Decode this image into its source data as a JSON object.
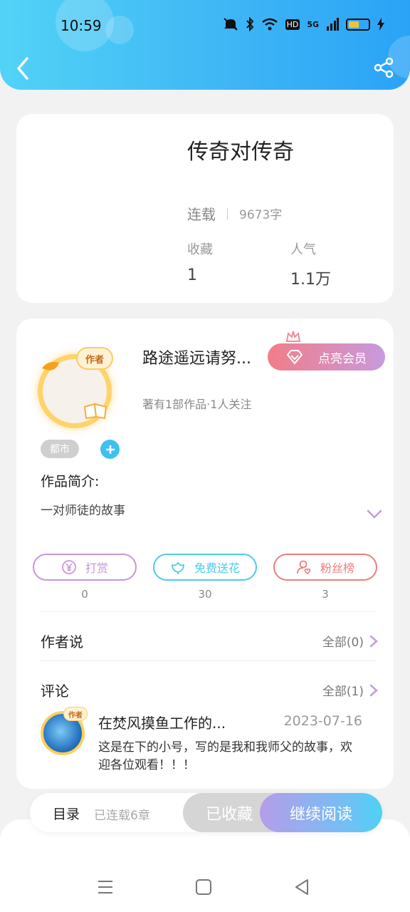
{
  "status_bar": {
    "time": "10:59",
    "network": "5G",
    "hd": "HD"
  },
  "book": {
    "title": "传奇对传奇",
    "status": "连载",
    "word_count": "9673字",
    "favorites_label": "收藏",
    "favorites_value": "1",
    "popularity_label": "人气",
    "popularity_value": "1.1万"
  },
  "author": {
    "badge": "作者",
    "name": "路途遥远请努...",
    "vip_label": "点亮会员",
    "meta": "著有1部作品·1人关注",
    "tag": "都市",
    "intro_label": "作品简介:",
    "intro_text": "一对师徒的故事"
  },
  "actions": [
    {
      "label": "打赏",
      "count": "0",
      "color": "#c895dd",
      "icon": "yuan-coin-icon"
    },
    {
      "label": "免费送花",
      "count": "30",
      "color": "#4dcbe9",
      "icon": "flower-icon"
    },
    {
      "label": "粉丝榜",
      "count": "3",
      "color": "#ee7d7d",
      "icon": "fan-ranking-icon"
    }
  ],
  "author_says": {
    "title": "作者说",
    "link": "全部(0)"
  },
  "comments": {
    "title": "评论",
    "link": "全部(1)",
    "items": [
      {
        "badge": "作者",
        "user": "在焚风摸鱼工作的...",
        "date": "2023-07-16",
        "text": "这是在下的小号，写的是我和我师父的故事，欢迎各位观看！！！"
      }
    ]
  },
  "bottom_bar": {
    "toc_label": "目录",
    "chapters": "已连载6章",
    "collected_label": "已收藏",
    "read_label": "继续阅读"
  }
}
